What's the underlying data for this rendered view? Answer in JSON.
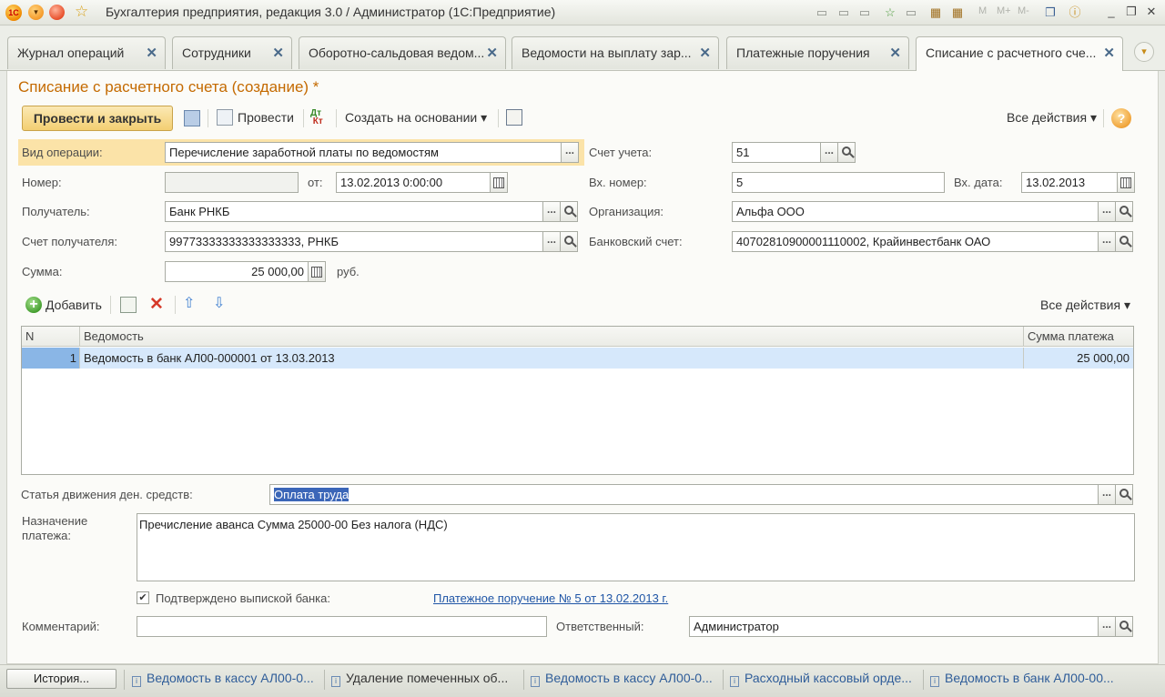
{
  "window": {
    "title": "Бухгалтерия предприятия, редакция 3.0 / Администратор  (1С:Предприятие)",
    "logo_text": "1С",
    "mem_buttons": [
      "M",
      "M+",
      "M-"
    ]
  },
  "tabs": [
    {
      "label": "Журнал операций"
    },
    {
      "label": "Сотрудники"
    },
    {
      "label": "Оборотно-сальдовая ведом..."
    },
    {
      "label": "Ведомости на выплату зар..."
    },
    {
      "label": "Платежные поручения"
    },
    {
      "label": "Списание с расчетного сче..."
    }
  ],
  "tab_close_glyph": "✕",
  "form": {
    "title": "Списание с расчетного счета (создание) *",
    "toolbar": {
      "post_close": "Провести и закрыть",
      "post": "Провести",
      "create_based": "Создать на основании",
      "all_actions": "Все действия",
      "help": "?"
    },
    "fields": {
      "operation_type_label": "Вид операции:",
      "operation_type_value": "Перечисление заработной платы по ведомостям",
      "account_label": "Счет учета:",
      "account_value": "51",
      "number_label": "Номер:",
      "number_value": "",
      "from_label": "от:",
      "from_value": "13.02.2013  0:00:00",
      "in_number_label": "Вх. номер:",
      "in_number_value": "5",
      "in_date_label": "Вх. дата:",
      "in_date_value": "13.02.2013",
      "recipient_label": "Получатель:",
      "recipient_value": "Банк РНКБ",
      "org_label": "Организация:",
      "org_value": "Альфа ООО",
      "recipient_account_label": "Счет получателя:",
      "recipient_account_value": "99773333333333333333, РНКБ",
      "bank_account_label": "Банковский счет:",
      "bank_account_value": "40702810900001110002, Крайинвестбанк ОАО",
      "sum_label": "Сумма:",
      "sum_value": "25 000,00",
      "currency": "руб."
    },
    "grid": {
      "add_label": "Добавить",
      "all_actions": "Все действия",
      "columns": [
        "N",
        "Ведомость",
        "Сумма платежа"
      ],
      "rows": [
        {
          "n": "1",
          "statement": "Ведомость в банк АЛ00-000001 от 13.03.2013",
          "amount": "25 000,00"
        }
      ]
    },
    "cashflow_label": "Статья движения ден. средств:",
    "cashflow_value": "Оплата труда",
    "purpose_label": "Назначение платежа:",
    "purpose_value": "Пречисление аванса Сумма 25000-00 Без налога (НДС)",
    "confirmed_label": "Подтверждено выпиской банка:",
    "confirmed_checked": true,
    "payment_link": "Платежное поручение № 5 от 13.02.2013 г.",
    "comment_label": "Комментарий:",
    "comment_value": "",
    "responsible_label": "Ответственный:",
    "responsible_value": "Администратор"
  },
  "taskbar": {
    "history": "История...",
    "items": [
      "Ведомость в кассу АЛ00-0...",
      "Удаление помеченных об...",
      "Ведомость в кассу АЛ00-0...",
      "Расходный кассовый орде...",
      "Ведомость в банк АЛ00-00..."
    ]
  }
}
